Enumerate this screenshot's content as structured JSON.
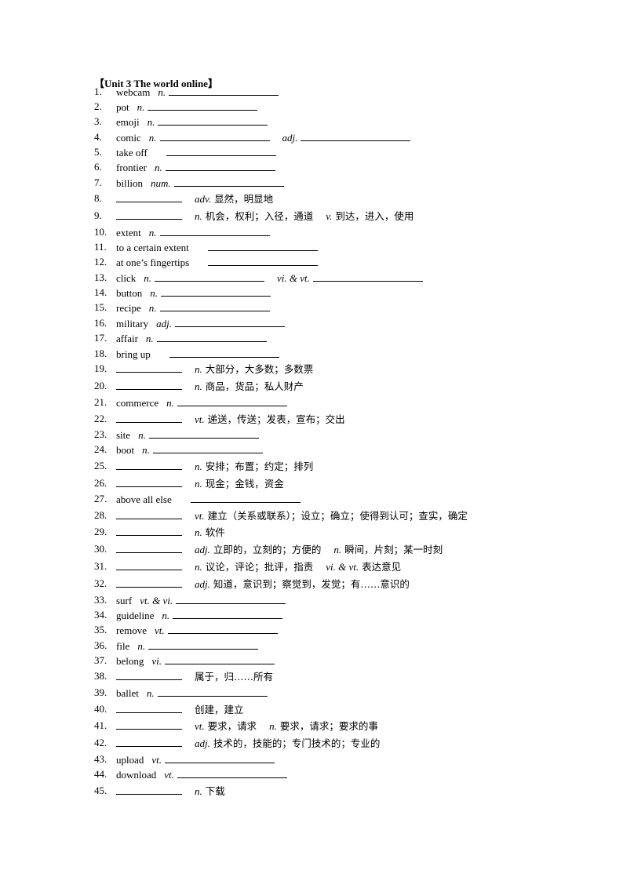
{
  "title": "【Unit 3 The world online】",
  "items": [
    {
      "n": "1.",
      "word": "webcam",
      "parts": [
        {
          "pos": "n.",
          "blank": true
        }
      ]
    },
    {
      "n": "2.",
      "word": "pot",
      "parts": [
        {
          "pos": "n.",
          "blank": true
        }
      ]
    },
    {
      "n": "3.",
      "word": "emoji",
      "parts": [
        {
          "pos": "n.",
          "blank": true
        }
      ]
    },
    {
      "n": "4.",
      "word": "comic",
      "parts": [
        {
          "pos": "n.",
          "blank": true
        },
        {
          "pos": "adj.",
          "blank": true
        }
      ]
    },
    {
      "n": "5.",
      "word": "take off",
      "parts": [
        {
          "pos": "",
          "blank": true
        }
      ]
    },
    {
      "n": "6.",
      "word": "frontier",
      "parts": [
        {
          "pos": "n.",
          "blank": true
        }
      ]
    },
    {
      "n": "7.",
      "word": "billion",
      "parts": [
        {
          "pos": "num.",
          "blank": true
        }
      ]
    },
    {
      "n": "8.",
      "word": "",
      "parts": [
        {
          "pos": "adv.",
          "cn": "显然，明显地"
        }
      ]
    },
    {
      "n": "9.",
      "word": "",
      "parts": [
        {
          "pos": "n.",
          "cn": "机会，权利；入径，通道"
        },
        {
          "pos": "v.",
          "cn": "到达，进入，使用"
        }
      ]
    },
    {
      "n": "10.",
      "word": "extent",
      "parts": [
        {
          "pos": "n.",
          "blank": true
        }
      ]
    },
    {
      "n": "11.",
      "word": "to a certain extent",
      "parts": [
        {
          "pos": "",
          "blank": true
        }
      ]
    },
    {
      "n": "12.",
      "word": "at one’s fingertips",
      "parts": [
        {
          "pos": "",
          "blank": true
        }
      ]
    },
    {
      "n": "13.",
      "word": "click",
      "parts": [
        {
          "pos": "n.",
          "blank": true
        },
        {
          "pos": "vi. & vt.",
          "blank": true
        }
      ]
    },
    {
      "n": "14.",
      "word": "button",
      "parts": [
        {
          "pos": "n.",
          "blank": true
        }
      ]
    },
    {
      "n": "15.",
      "word": "recipe",
      "parts": [
        {
          "pos": "n.",
          "blank": true
        }
      ]
    },
    {
      "n": "16.",
      "word": "military",
      "parts": [
        {
          "pos": "adj.",
          "blank": true
        }
      ]
    },
    {
      "n": "17.",
      "word": "affair",
      "parts": [
        {
          "pos": "n.",
          "blank": true
        }
      ]
    },
    {
      "n": "18.",
      "word": "bring up",
      "parts": [
        {
          "pos": "",
          "blank": true
        }
      ]
    },
    {
      "n": "19.",
      "word": "",
      "parts": [
        {
          "pos": "n.",
          "cn": "大部分，大多数；多数票"
        }
      ]
    },
    {
      "n": "20.",
      "word": "",
      "parts": [
        {
          "pos": "n.",
          "cn": "商品，货品；私人财产"
        }
      ]
    },
    {
      "n": "21.",
      "word": "commerce",
      "parts": [
        {
          "pos": "n.",
          "blank": true
        }
      ]
    },
    {
      "n": "22.",
      "word": "",
      "parts": [
        {
          "pos": "vt.",
          "cn": "递送，传送；发表，宣布；交出"
        }
      ]
    },
    {
      "n": "23.",
      "word": "site",
      "parts": [
        {
          "pos": "n.",
          "blank": true
        }
      ]
    },
    {
      "n": "24.",
      "word": "boot",
      "parts": [
        {
          "pos": "n.",
          "blank": true
        }
      ]
    },
    {
      "n": "25.",
      "word": "",
      "parts": [
        {
          "pos": "n.",
          "cn": "安排；布置；约定；排列"
        }
      ]
    },
    {
      "n": "26.",
      "word": "",
      "parts": [
        {
          "pos": "n.",
          "cn": "现金；金钱，资金"
        }
      ]
    },
    {
      "n": "27.",
      "word": "above all else",
      "parts": [
        {
          "pos": "",
          "blank": true
        }
      ]
    },
    {
      "n": "28.",
      "word": "",
      "parts": [
        {
          "pos": "vt.",
          "cn": "建立（关系或联系）；设立；确立；使得到认可；查实，确定"
        }
      ]
    },
    {
      "n": "29.",
      "word": "",
      "parts": [
        {
          "pos": "n.",
          "cn": "软件"
        }
      ]
    },
    {
      "n": "30.",
      "word": "",
      "parts": [
        {
          "pos": "adj.",
          "cn": "立即的，立刻的；方便的"
        },
        {
          "pos": "n.",
          "cn": "瞬间，片刻；某一时刻"
        }
      ]
    },
    {
      "n": "31.",
      "word": "",
      "parts": [
        {
          "pos": "n.",
          "cn": "议论，评论；批评，指责"
        },
        {
          "pos": "vi. & vt.",
          "cn": "表达意见"
        }
      ]
    },
    {
      "n": "32.",
      "word": "",
      "parts": [
        {
          "pos": "adj.",
          "cn": "知道，意识到；察觉到，发觉；有……意识的"
        }
      ]
    },
    {
      "n": "33.",
      "word": "surf",
      "parts": [
        {
          "pos": "vt. & vi.",
          "blank": true
        }
      ]
    },
    {
      "n": "34.",
      "word": "guideline",
      "parts": [
        {
          "pos": "n.",
          "blank": true
        }
      ]
    },
    {
      "n": "35.",
      "word": "remove",
      "parts": [
        {
          "pos": "vt.",
          "blank": true
        }
      ]
    },
    {
      "n": "36.",
      "word": "file",
      "parts": [
        {
          "pos": "n.",
          "blank": true
        }
      ]
    },
    {
      "n": "37.",
      "word": "belong",
      "parts": [
        {
          "pos": "vi.",
          "blank": true
        }
      ]
    },
    {
      "n": "38.",
      "word": "",
      "parts": [
        {
          "pos": "",
          "cn": "属于，归……所有"
        }
      ]
    },
    {
      "n": "39.",
      "word": "ballet",
      "parts": [
        {
          "pos": "n.",
          "blank": true
        }
      ]
    },
    {
      "n": "40.",
      "word": "",
      "parts": [
        {
          "pos": "",
          "cn": "创建，建立"
        }
      ]
    },
    {
      "n": "41.",
      "word": "",
      "parts": [
        {
          "pos": "vt.",
          "cn": "要求，请求"
        },
        {
          "pos": "n.",
          "cn": "要求，请求；要求的事"
        }
      ]
    },
    {
      "n": "42.",
      "word": "",
      "parts": [
        {
          "pos": "adj.",
          "cn": "技术的，技能的；专门技术的；专业的"
        }
      ]
    },
    {
      "n": "43.",
      "word": "upload",
      "parts": [
        {
          "pos": "vt.",
          "blank": true
        }
      ]
    },
    {
      "n": "44.",
      "word": "download",
      "parts": [
        {
          "pos": "vt.",
          "blank": true
        }
      ]
    },
    {
      "n": "45.",
      "word": "",
      "parts": [
        {
          "pos": "n.",
          "cn": "下载"
        }
      ]
    }
  ]
}
